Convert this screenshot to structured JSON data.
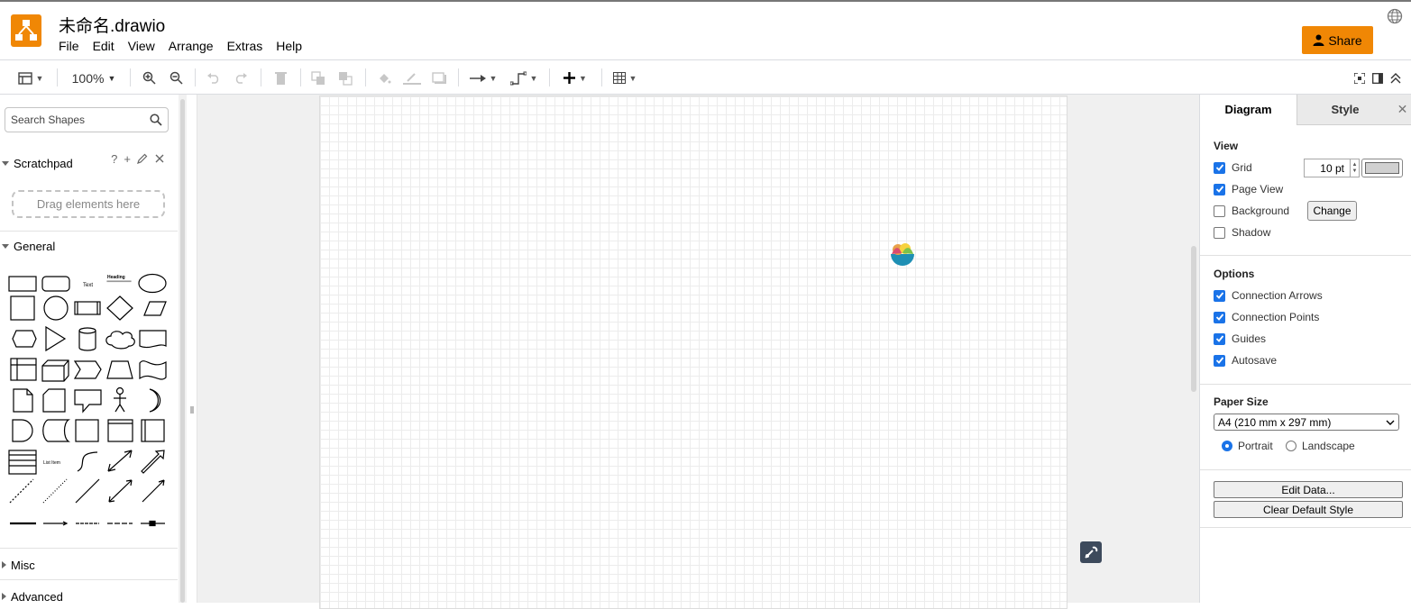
{
  "app": {
    "title": "未命名.drawio",
    "menu": [
      "File",
      "Edit",
      "View",
      "Arrange",
      "Extras",
      "Help"
    ],
    "share_label": "Share"
  },
  "toolbar": {
    "zoom": "100%"
  },
  "sidebar": {
    "search_placeholder": "Search Shapes",
    "scratchpad_title": "Scratchpad",
    "scratchpad_help": "?",
    "scratchpad_add": "+",
    "drag_hint": "Drag elements here",
    "general_title": "General",
    "misc_title": "Misc",
    "advanced_title": "Advanced",
    "shape_text_label": "Text",
    "shape_heading_label": "Heading",
    "shape_list_label": "List Item"
  },
  "panel": {
    "tabs": [
      "Diagram",
      "Style"
    ],
    "view_title": "View",
    "grid_label": "Grid",
    "grid_checked": true,
    "grid_size": "10 pt",
    "grid_color": "#d0d0d0",
    "page_view_label": "Page View",
    "page_view_checked": true,
    "background_label": "Background",
    "background_checked": false,
    "change_label": "Change",
    "shadow_label": "Shadow",
    "shadow_checked": false,
    "options_title": "Options",
    "connection_arrows_label": "Connection Arrows",
    "connection_points_label": "Connection Points",
    "guides_label": "Guides",
    "autosave_label": "Autosave",
    "paper_title": "Paper Size",
    "paper_size": "A4 (210 mm x 297 mm)",
    "portrait_label": "Portrait",
    "landscape_label": "Landscape",
    "orientation": "Portrait",
    "edit_data_label": "Edit Data...",
    "clear_style_label": "Clear Default Style"
  },
  "colors": {
    "accent": "#f08705",
    "checkbox": "#1a73e8"
  }
}
